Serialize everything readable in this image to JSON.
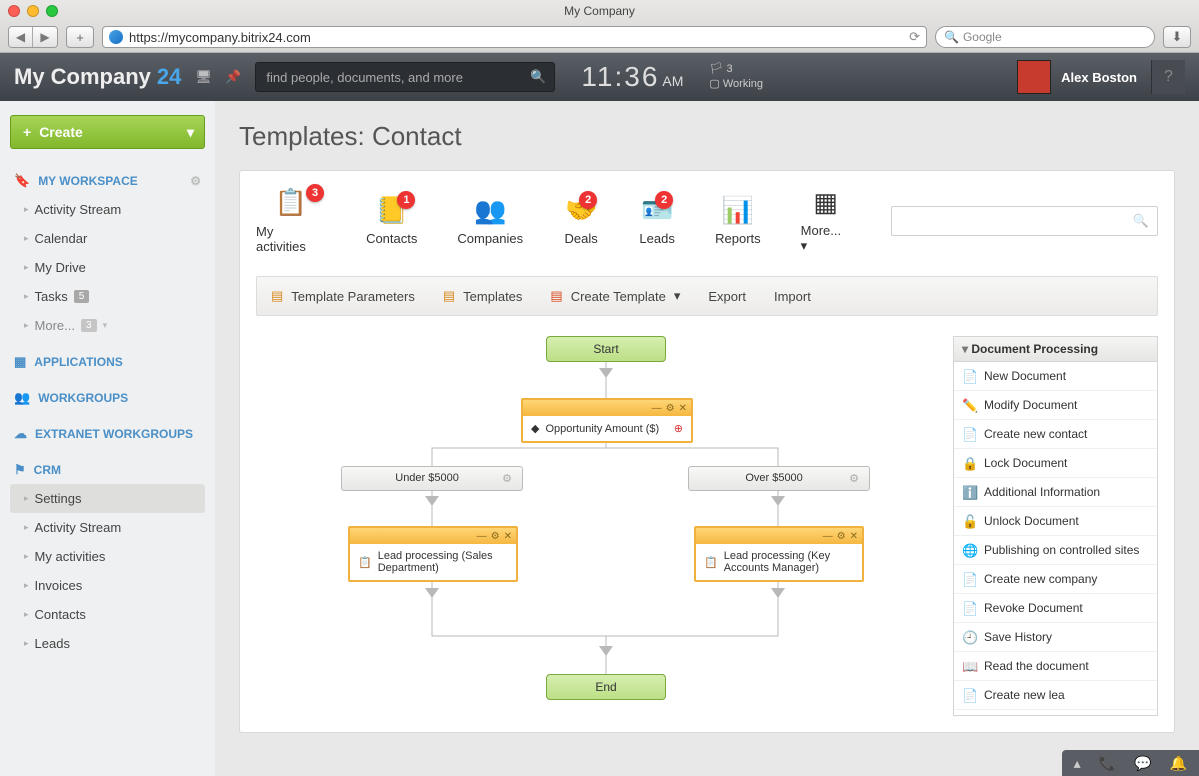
{
  "browser": {
    "title": "My Company",
    "url": "https://mycompany.bitrix24.com",
    "search_placeholder": "Google"
  },
  "header": {
    "brand": "My Company",
    "brand_suffix": "24",
    "search_placeholder": "find people, documents, and more",
    "clock_time": "11:36",
    "clock_ampm": "AM",
    "status_count": "3",
    "status_text": "Working",
    "user_name": "Alex Boston"
  },
  "sidebar": {
    "create_label": "Create",
    "sections": {
      "workspace": "MY WORKSPACE",
      "applications": "APPLICATIONS",
      "workgroups": "WORKGROUPS",
      "extranet": "EXTRANET WORKGROUPS",
      "crm": "CRM"
    },
    "ws_items": [
      "Activity Stream",
      "Calendar",
      "My Drive",
      "Tasks",
      "More..."
    ],
    "ws_tasks_badge": "5",
    "ws_more_badge": "3",
    "crm_items": [
      "Settings",
      "Activity Stream",
      "My activities",
      "Invoices",
      "Contacts",
      "Leads"
    ]
  },
  "page": {
    "title": "Templates: Contact",
    "toolbar": [
      {
        "label": "My activities",
        "badge": "3"
      },
      {
        "label": "Contacts",
        "badge": "1"
      },
      {
        "label": "Companies"
      },
      {
        "label": "Deals",
        "badge": "2"
      },
      {
        "label": "Leads",
        "badge": "2"
      },
      {
        "label": "Reports"
      },
      {
        "label": "More..."
      }
    ],
    "subbar": [
      "Template Parameters",
      "Templates",
      "Create Template",
      "Export",
      "Import"
    ]
  },
  "flow": {
    "start": "Start",
    "end": "End",
    "opportunity": "Opportunity Amount ($)",
    "branch1": "Under $5000",
    "branch2": "Over $5000",
    "lead1": "Lead processing (Sales Department)",
    "lead2": "Lead processing (Key Accounts Manager)"
  },
  "doc_panel": {
    "title": "Document Processing",
    "items": [
      "New Document",
      "Modify Document",
      "Create new contact",
      "Lock Document",
      "Additional Information",
      "Unlock Document",
      "Publishing on controlled sites",
      "Create new company",
      "Revoke Document",
      "Save History",
      "Read the document",
      "Create new lea"
    ]
  }
}
